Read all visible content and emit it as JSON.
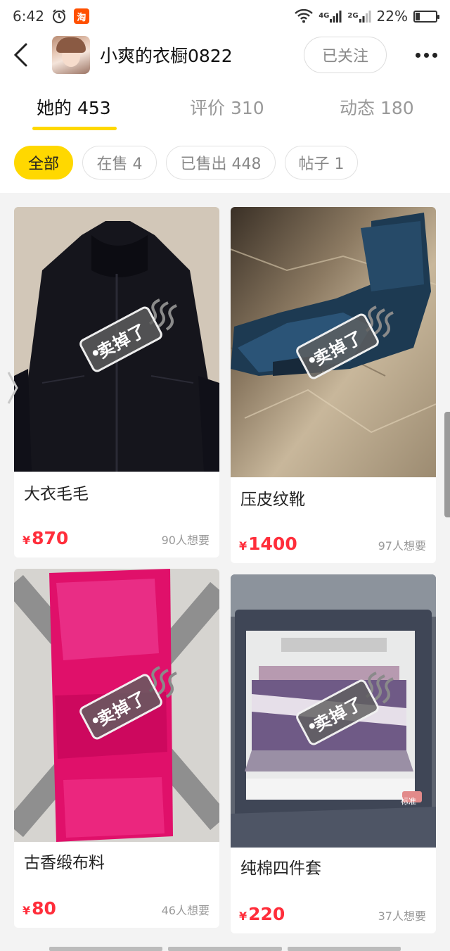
{
  "status_bar": {
    "time": "6:42",
    "app_badge": "淘",
    "network_1": "4G",
    "network_2": "2G",
    "battery": "22%",
    "battery_level": 0.22
  },
  "header": {
    "shop_name": "小爽的衣橱0822",
    "follow_label": "已关注"
  },
  "tabs": [
    {
      "label": "她的 453",
      "active": true
    },
    {
      "label": "评价 310",
      "active": false
    },
    {
      "label": "动态 180",
      "active": false
    }
  ],
  "filters": [
    {
      "label": "全部",
      "active": true
    },
    {
      "label": "在售 4",
      "active": false
    },
    {
      "label": "已售出 448",
      "active": false
    },
    {
      "label": "帖子 1",
      "active": false
    }
  ],
  "sold_stamp_text": "卖掉了",
  "products": [
    {
      "title": "大衣毛毛",
      "currency": "¥",
      "price": "870",
      "wants": "90人想要",
      "image": "black-coat"
    },
    {
      "title": "压皮纹靴",
      "currency": "¥",
      "price": "1400",
      "wants": "97人想要",
      "image": "blue-boots"
    },
    {
      "title": "古香缎布料",
      "currency": "¥",
      "price": "80",
      "wants": "46人想要",
      "image": "pink-satin"
    },
    {
      "title": "纯棉四件套",
      "currency": "¥",
      "price": "220",
      "wants": "37人想要",
      "image": "bedding-set",
      "image_tag": "标准"
    }
  ],
  "colors": {
    "accent_yellow": "#ffd800",
    "price_red": "#ff2e3b",
    "muted_text": "#999999"
  }
}
